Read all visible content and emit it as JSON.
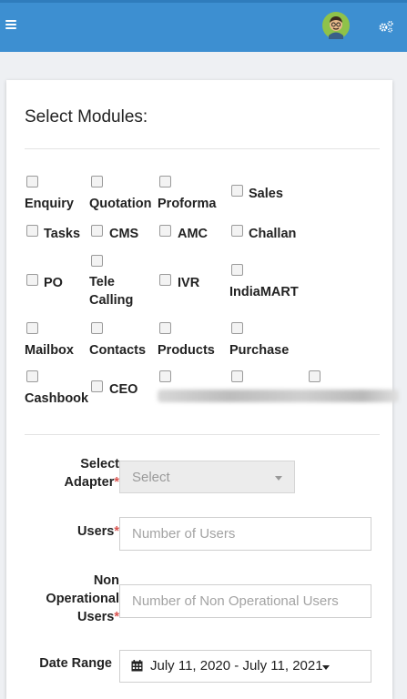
{
  "colors": {
    "header": "#3d8fd1",
    "required": "#d9534f"
  },
  "header": {
    "menu_icon": "hamburger-icon",
    "avatar_icon": "user-avatar",
    "settings_icon": "gears-icon"
  },
  "modules": {
    "title": "Select Modules:",
    "items": [
      {
        "label": "Enquiry"
      },
      {
        "label": "Quotation"
      },
      {
        "label": "Proforma"
      },
      {
        "label": "Sales"
      },
      {
        "label": "Tasks"
      },
      {
        "label": "CMS"
      },
      {
        "label": "AMC"
      },
      {
        "label": "Challan"
      },
      {
        "label": "PO"
      },
      {
        "label": "Tele\nCalling"
      },
      {
        "label": "IVR"
      },
      {
        "label": "IndiaMART"
      },
      {
        "label": "Mailbox"
      },
      {
        "label": "Contacts"
      },
      {
        "label": "Products"
      },
      {
        "label": "Purchase"
      },
      {
        "label": "Cashbook"
      },
      {
        "label": "CEO"
      }
    ]
  },
  "form": {
    "adapter": {
      "label": "Select\nAdapter",
      "required": "*",
      "value": "Select"
    },
    "users": {
      "label": "Users",
      "required": "*",
      "placeholder": "Number of Users"
    },
    "non_operational": {
      "label": "Non\nOperational\nUsers",
      "required": "*",
      "placeholder": "Number of Non Operational Users"
    },
    "date_range": {
      "label": "Date Range",
      "value": "July 11, 2020 - July 11, 2021"
    }
  }
}
